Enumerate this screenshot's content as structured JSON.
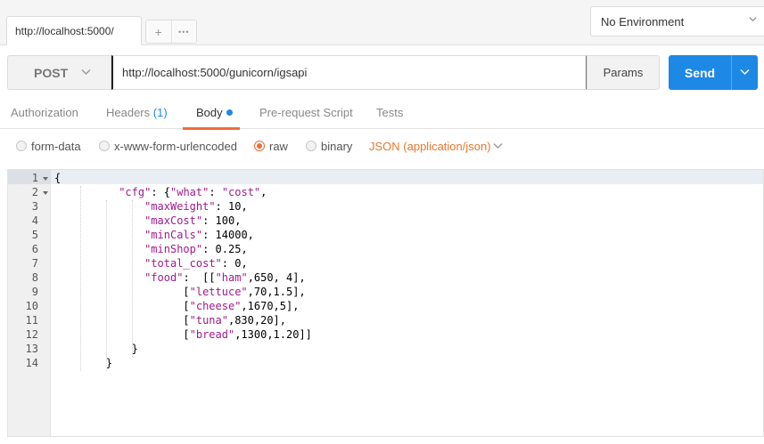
{
  "tabs": {
    "active_tab_label": "http://localhost:5000/",
    "add_icon": "+",
    "more_icon": "•••"
  },
  "environment": {
    "selected": "No Environment"
  },
  "request": {
    "method": "POST",
    "url": "http://localhost:5000/gunicorn/igsapi",
    "params_label": "Params",
    "send_label": "Send"
  },
  "subtabs": {
    "authorization": "Authorization",
    "headers": "Headers",
    "headers_count": "(1)",
    "body": "Body",
    "prerequest": "Pre-request Script",
    "tests": "Tests"
  },
  "body_options": {
    "form_data": "form-data",
    "urlencoded": "x-www-form-urlencoded",
    "raw": "raw",
    "binary": "binary",
    "selected": "raw",
    "content_type": "JSON (application/json)"
  },
  "editor": {
    "lines": [
      {
        "n": "1",
        "fold": true,
        "indent": 0,
        "tokens": [
          [
            "p",
            "{"
          ]
        ]
      },
      {
        "n": "2",
        "fold": true,
        "indent": 10,
        "tokens": [
          [
            "s",
            "\"cfg\""
          ],
          [
            "p",
            ": {"
          ],
          [
            "s",
            "\"what\""
          ],
          [
            "p",
            ": "
          ],
          [
            "s",
            "\"cost\""
          ],
          [
            "p",
            ","
          ]
        ]
      },
      {
        "n": "3",
        "fold": false,
        "indent": 14,
        "tokens": [
          [
            "s",
            "\"maxWeight\""
          ],
          [
            "p",
            ": 10,"
          ]
        ]
      },
      {
        "n": "4",
        "fold": false,
        "indent": 14,
        "tokens": [
          [
            "s",
            "\"maxCost\""
          ],
          [
            "p",
            ": 100,"
          ]
        ]
      },
      {
        "n": "5",
        "fold": false,
        "indent": 14,
        "tokens": [
          [
            "s",
            "\"minCals\""
          ],
          [
            "p",
            ": 14000,"
          ]
        ]
      },
      {
        "n": "6",
        "fold": false,
        "indent": 14,
        "tokens": [
          [
            "s",
            "\"minShop\""
          ],
          [
            "p",
            ": 0.25,"
          ]
        ]
      },
      {
        "n": "7",
        "fold": false,
        "indent": 14,
        "tokens": [
          [
            "s",
            "\"total_cost\""
          ],
          [
            "p",
            ": 0,"
          ]
        ]
      },
      {
        "n": "8",
        "fold": false,
        "indent": 14,
        "tokens": [
          [
            "s",
            "\"food\""
          ],
          [
            "p",
            ":  [["
          ],
          [
            "s",
            "\"ham\""
          ],
          [
            "p",
            ",650, 4],"
          ]
        ]
      },
      {
        "n": "9",
        "fold": false,
        "indent": 20,
        "tokens": [
          [
            "p",
            "["
          ],
          [
            "s",
            "\"lettuce\""
          ],
          [
            "p",
            ",70,1.5],"
          ]
        ]
      },
      {
        "n": "10",
        "fold": false,
        "indent": 20,
        "tokens": [
          [
            "p",
            "["
          ],
          [
            "s",
            "\"cheese\""
          ],
          [
            "p",
            ",1670,5],"
          ]
        ]
      },
      {
        "n": "11",
        "fold": false,
        "indent": 20,
        "tokens": [
          [
            "p",
            "["
          ],
          [
            "s",
            "\"tuna\""
          ],
          [
            "p",
            ",830,20],"
          ]
        ]
      },
      {
        "n": "12",
        "fold": false,
        "indent": 20,
        "tokens": [
          [
            "p",
            "["
          ],
          [
            "s",
            "\"bread\""
          ],
          [
            "p",
            ",1300,1.20]]"
          ]
        ]
      },
      {
        "n": "13",
        "fold": false,
        "indent": 12,
        "tokens": [
          [
            "p",
            "}"
          ]
        ]
      },
      {
        "n": "14",
        "fold": false,
        "indent": 8,
        "tokens": [
          [
            "p",
            "}"
          ]
        ]
      }
    ]
  },
  "colors": {
    "accent_orange": "#f26b3a",
    "send_blue": "#1e88e5",
    "json_string": "#a11a8e",
    "content_type": "#e8772e"
  },
  "icons": {
    "method_dropdown": "chevron-down-icon",
    "send_dropdown": "chevron-down-icon",
    "env_dropdown": "chevron-down-icon",
    "fold": "fold-arrow-icon"
  }
}
